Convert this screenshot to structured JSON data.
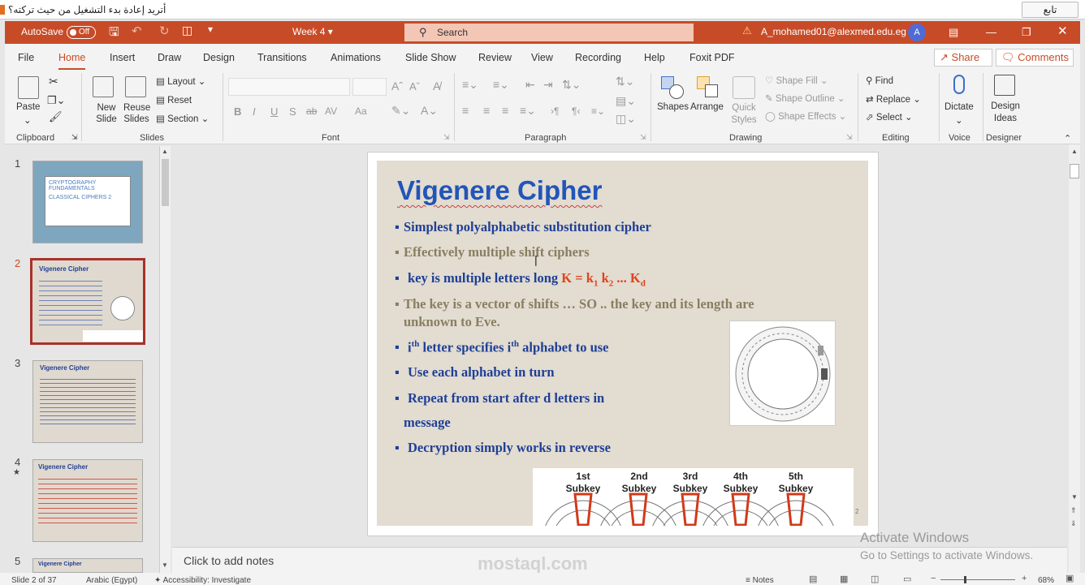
{
  "notification": {
    "message": "أتريد إعادة بدء التشغيل من حيث تركته؟",
    "follow_label": "تابع"
  },
  "titlebar": {
    "autosave_label": "AutoSave",
    "autosave_state": "Off",
    "doc_title": "Week 4",
    "search_placeholder": "Search",
    "account": "A_mohamed01@alexmed.edu.eg",
    "avatar_initial": "A"
  },
  "tabs": [
    "File",
    "Home",
    "Insert",
    "Draw",
    "Design",
    "Transitions",
    "Animations",
    "Slide Show",
    "Review",
    "View",
    "Recording",
    "Help",
    "Foxit PDF"
  ],
  "share_label": "Share",
  "comments_label": "Comments",
  "ribbon": {
    "clipboard": {
      "paste": "Paste",
      "group": "Clipboard"
    },
    "slides": {
      "new_slide": "New Slide",
      "reuse_slides": "Reuse Slides",
      "layout": "Layout",
      "reset": "Reset",
      "section": "Section",
      "group": "Slides"
    },
    "font": {
      "group": "Font",
      "bold": "B",
      "italic": "I",
      "underline": "U",
      "shadow": "S",
      "strike": "ab",
      "spacing": "AV",
      "case": "Aa"
    },
    "paragraph": {
      "group": "Paragraph"
    },
    "drawing": {
      "shapes": "Shapes",
      "arrange": "Arrange",
      "quick_styles": "Quick Styles",
      "shape_fill": "Shape Fill",
      "shape_outline": "Shape Outline",
      "shape_effects": "Shape Effects",
      "group": "Drawing"
    },
    "editing": {
      "find": "Find",
      "replace": "Replace",
      "select": "Select",
      "group": "Editing"
    },
    "voice": {
      "dictate": "Dictate",
      "group": "Voice"
    },
    "designer": {
      "design_ideas": "Design Ideas",
      "group": "Designer"
    }
  },
  "thumbnails": [
    {
      "num": "1",
      "title": "CRYPTOGRAPHY FUNDAMENTALS",
      "subtitle": "CLASSICAL CIPHERS 2"
    },
    {
      "num": "2",
      "title": "Vigenere Cipher"
    },
    {
      "num": "3",
      "title": "Vigenere Cipher"
    },
    {
      "num": "4",
      "title": "Vigenere Cipher",
      "star": "★"
    },
    {
      "num": "5",
      "title": "Vigenere Cipher"
    }
  ],
  "slide": {
    "title": "Vigenere Cipher",
    "b1": "Simplest polyalphabetic substitution cipher",
    "b2": "Effectively multiple shift ciphers",
    "b3_text": "key is multiple letters long ",
    "b3_formula": "K = k",
    "b3_sub1": "1",
    "b3_k2": " k",
    "b3_sub2": "2",
    "b3_dots": " ... K",
    "b3_subd": "d",
    "b4_line1": "The key is a vector of shifts … SO .. the key and its length are",
    "b4_line2": "unknown to Eve.",
    "b5_i": "i",
    "b5_th": "th",
    "b5_mid": " letter specifies i",
    "b5_end": " alphabet to use",
    "b6": "Use each alphabet in turn",
    "b7_line1": "Repeat from start after d letters in",
    "b7_line2": "message",
    "b8": "Decryption simply works in reverse",
    "subkeys": [
      "1st Subkey",
      "2nd Subkey",
      "3rd Subkey",
      "4th Subkey",
      "5th Subkey"
    ],
    "page_num": "2"
  },
  "notes_placeholder": "Click to add notes",
  "watermark": {
    "brand": "mostaql.com",
    "activate_title": "Activate Windows",
    "activate_sub": "Go to Settings to activate Windows."
  },
  "status": {
    "slide_info": "Slide 2 of 37",
    "language": "Arabic (Egypt)",
    "accessibility": "Accessibility: Investigate",
    "notes": "Notes",
    "zoom": "68%"
  },
  "colors": {
    "accent": "#c84b27",
    "slide_blue": "#1f3f96",
    "slide_red": "#e0441c"
  }
}
